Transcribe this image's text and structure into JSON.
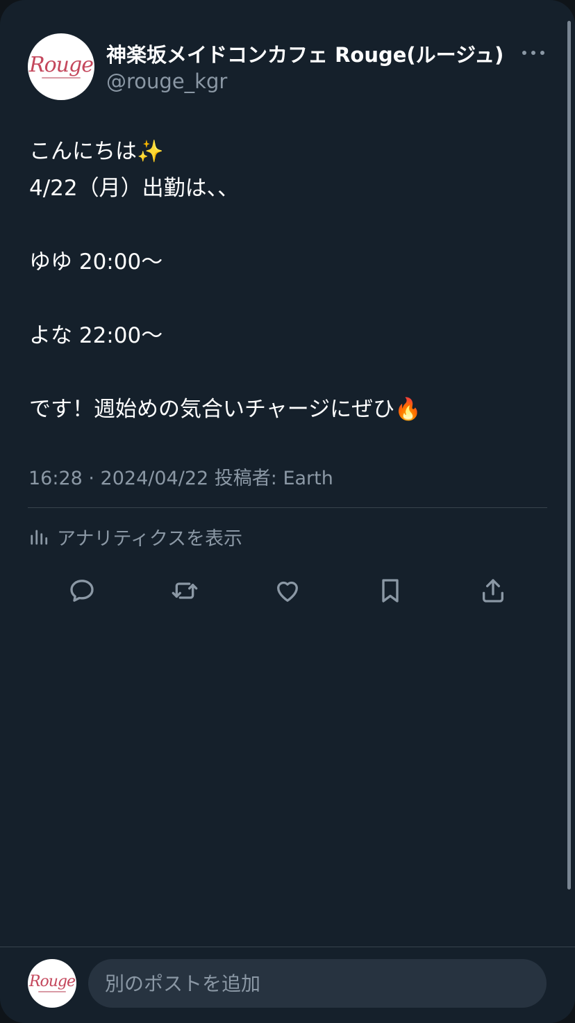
{
  "post": {
    "author": {
      "display_name": "神楽坂メイドコンカフェ Rouge(ルージュ)",
      "handle": "@rouge_kgr",
      "avatar_logo": "Rouge"
    },
    "more_icon": "more-horizontal-icon",
    "body_lines": [
      "こんにちは✨",
      "4/22（月）出勤は、、",
      "",
      "ゆゆ 20:00～",
      "",
      "よな 22:00～",
      "",
      "です！週始めの気合いチャージにぜひ🔥"
    ],
    "meta": "16:28 · 2024/04/22 投稿者: Earth",
    "analytics_label": "アナリティクスを表示",
    "actions": [
      {
        "name": "reply",
        "icon": "reply-icon"
      },
      {
        "name": "repost",
        "icon": "repost-icon"
      },
      {
        "name": "like",
        "icon": "heart-icon"
      },
      {
        "name": "bookmark",
        "icon": "bookmark-icon"
      },
      {
        "name": "share",
        "icon": "share-icon"
      }
    ]
  },
  "composer": {
    "placeholder": "別のポストを追加",
    "avatar_logo": "Rouge"
  },
  "colors": {
    "background": "#15202b",
    "text_primary": "#ffffff",
    "text_secondary": "#8b98a5",
    "divider": "#38444d",
    "input_bg": "#273340",
    "logo": "#c4475c"
  }
}
